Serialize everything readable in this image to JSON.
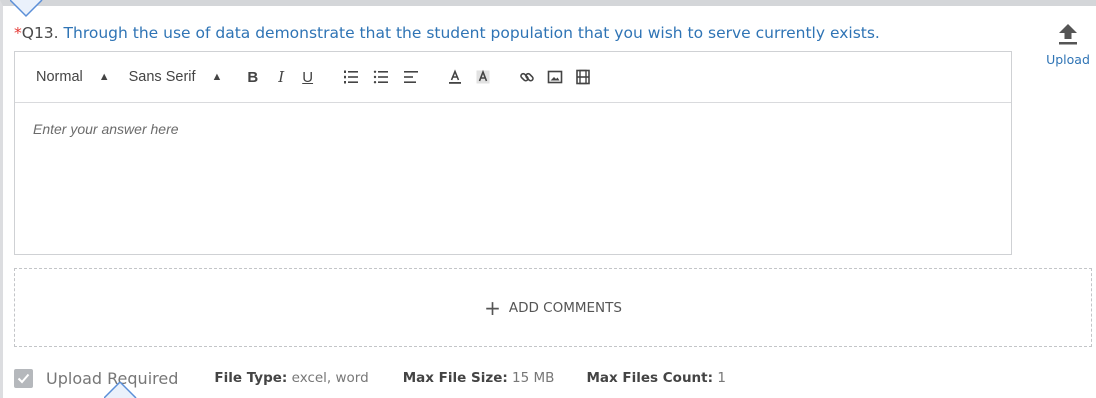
{
  "question": {
    "required_marker": "*",
    "number": "Q13.",
    "text": "Through the use of data demonstrate that the student population that you wish to serve currently exists."
  },
  "upload_button": {
    "icon": "upload-arrow-icon",
    "label": "Upload"
  },
  "toolbar": {
    "format_select": "Normal",
    "font_select": "Sans Serif",
    "bold": "B",
    "italic": "I",
    "underline": "U",
    "icons": [
      "ordered-list-icon",
      "bullet-list-icon",
      "align-icon",
      "text-color-icon",
      "background-color-icon",
      "link-icon",
      "image-icon",
      "video-icon"
    ]
  },
  "answer": {
    "placeholder": "Enter your answer here"
  },
  "comments": {
    "plus": "+",
    "label": "ADD COMMENTS"
  },
  "footer": {
    "upload_required_label": "Upload Required",
    "upload_required_checked": true,
    "file_type_label": "File Type:",
    "file_type_value": "excel, word",
    "max_size_label": "Max File Size:",
    "max_size_value": "15 MB",
    "max_count_label": "Max Files Count:",
    "max_count_value": "1"
  },
  "colors": {
    "question_text": "#2f74b5",
    "required_star": "#e53935",
    "callout": "#5b8fd8"
  }
}
